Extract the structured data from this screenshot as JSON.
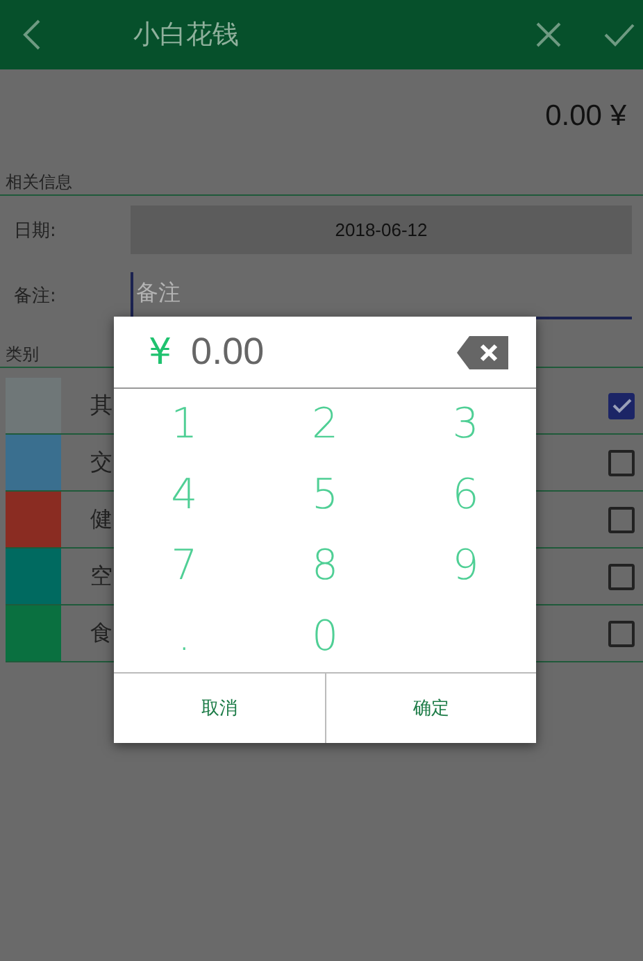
{
  "header": {
    "title": "小白花钱"
  },
  "amount": "0.00 ¥",
  "info": {
    "heading": "相关信息",
    "date": {
      "label": "日期:",
      "value": "2018-06-12"
    },
    "note": {
      "label": "备注:",
      "placeholder": "备注"
    }
  },
  "category": {
    "heading": "类别",
    "items": [
      {
        "label": "其",
        "color": "#6f7778",
        "checked": true
      },
      {
        "label": "交",
        "color": "#3a6f8f",
        "checked": false
      },
      {
        "label": "健",
        "color": "#8a2c22",
        "checked": false
      },
      {
        "label": "空",
        "color": "#006a60",
        "checked": false
      },
      {
        "label": "食",
        "color": "#0a7040",
        "checked": false
      }
    ]
  },
  "keypad": {
    "currency": "¥",
    "value": "0.00",
    "key_rows": [
      [
        "1",
        "2",
        "3"
      ],
      [
        "4",
        "5",
        "6"
      ],
      [
        "7",
        "8",
        "9"
      ],
      [
        ".",
        "0"
      ]
    ],
    "cancel": "取消",
    "confirm": "确定"
  }
}
